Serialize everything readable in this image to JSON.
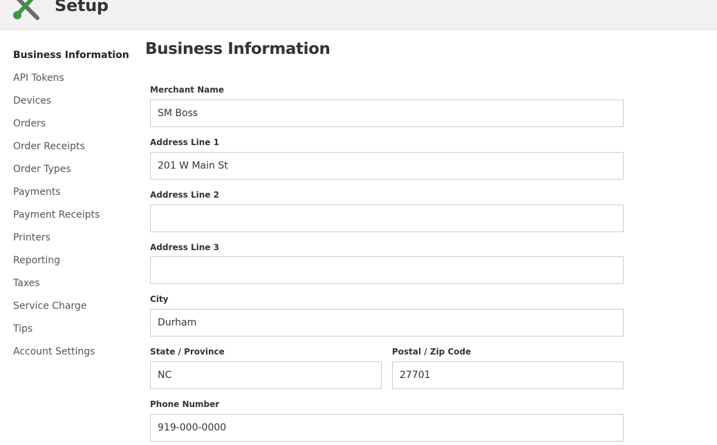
{
  "header": {
    "title": "Setup",
    "icon": "tools-icon"
  },
  "sidebar": {
    "items": [
      {
        "label": "Business Information",
        "active": true
      },
      {
        "label": "API Tokens"
      },
      {
        "label": "Devices"
      },
      {
        "label": "Orders"
      },
      {
        "label": "Order Receipts"
      },
      {
        "label": "Order Types"
      },
      {
        "label": "Payments"
      },
      {
        "label": "Payment Receipts"
      },
      {
        "label": "Printers"
      },
      {
        "label": "Reporting"
      },
      {
        "label": "Taxes"
      },
      {
        "label": "Service Charge"
      },
      {
        "label": "Tips"
      },
      {
        "label": "Account Settings"
      }
    ]
  },
  "main": {
    "title": "Business Information",
    "fields": {
      "merchant_name": {
        "label": "Merchant Name",
        "value": "SM Boss"
      },
      "address_line_1": {
        "label": "Address Line 1",
        "value": "201 W Main St"
      },
      "address_line_2": {
        "label": "Address Line 2",
        "value": ""
      },
      "address_line_3": {
        "label": "Address Line 3",
        "value": ""
      },
      "city": {
        "label": "City",
        "value": "Durham"
      },
      "state": {
        "label": "State / Province",
        "value": "NC"
      },
      "postal": {
        "label": "Postal / Zip Code",
        "value": "27701"
      },
      "phone": {
        "label": "Phone Number",
        "value": "919-000-0000"
      }
    }
  },
  "colors": {
    "header_bg": "#f1f1f1",
    "icon_green": "#3a9a3a",
    "icon_gray": "#6b6b6b"
  }
}
